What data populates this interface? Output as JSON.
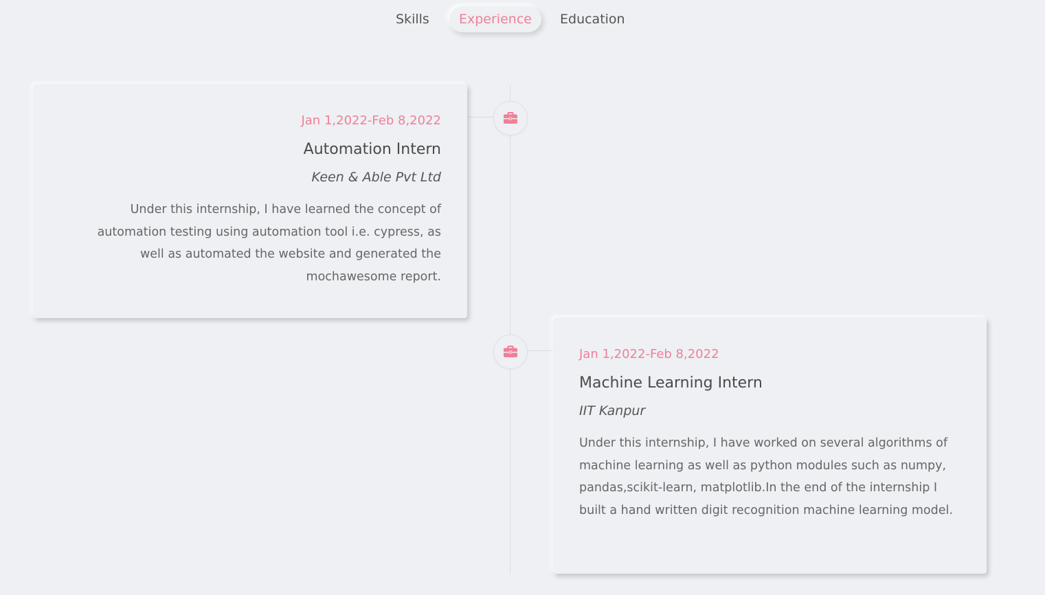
{
  "tabs": [
    {
      "label": "Skills",
      "active": false
    },
    {
      "label": "Experience",
      "active": true
    },
    {
      "label": "Education",
      "active": false
    }
  ],
  "accent_color": "#f07f99",
  "timeline_icon": "briefcase-icon",
  "experience": [
    {
      "date": "Jan 1,2022-Feb 8,2022",
      "title": "Automation Intern",
      "company": "Keen & Able Pvt Ltd",
      "description": "Under this internship, I have learned the concept of automation testing using automation tool i.e. cypress, as well as automated the website and generated the mochawesome report."
    },
    {
      "date": "Jan 1,2022-Feb 8,2022",
      "title": "Machine Learning Intern",
      "company": "IIT Kanpur",
      "description": "Under this internship, I have worked on several algorithms of machine learning as well as python modules such as numpy, pandas,scikit-learn, matplotlib.In the end of the internship I built a hand written digit recognition machine learning model."
    }
  ]
}
